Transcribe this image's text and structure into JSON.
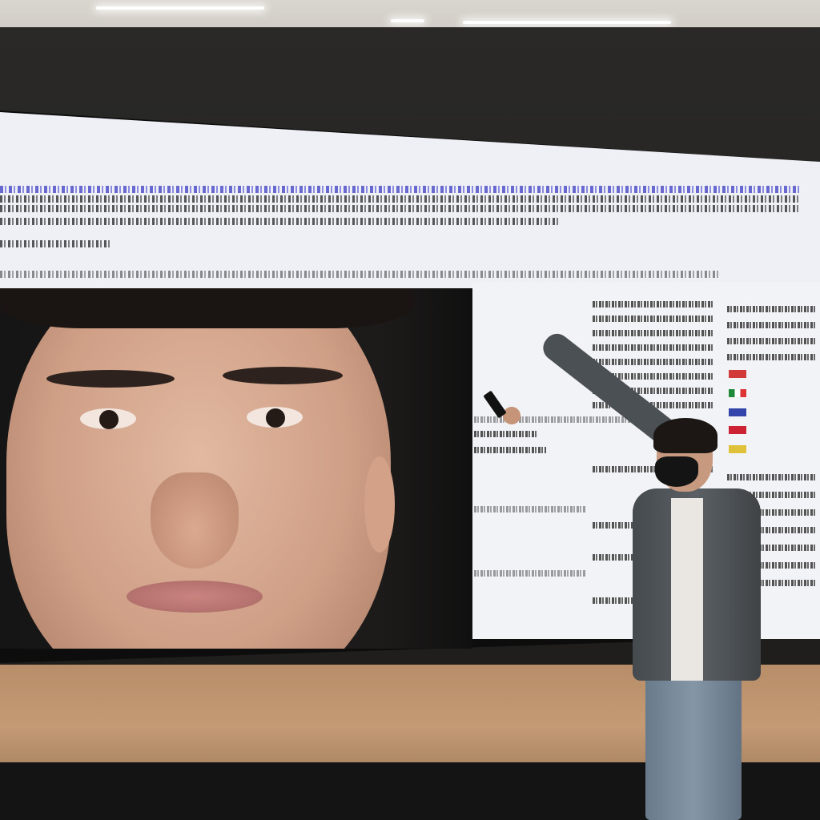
{
  "scene": {
    "description_colors": {
      "browser_bg": "#eef0f6",
      "link_blue": "#3b3cc4",
      "floor": "#c39a74",
      "jacket": "#4b5054"
    }
  },
  "icons": [
    "ceiling-light-icon",
    "phone-icon",
    "flag-icon"
  ]
}
